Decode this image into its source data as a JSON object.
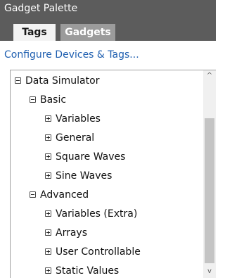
{
  "panel": {
    "title": "Gadget Palette",
    "tabs": [
      {
        "label": "Tags",
        "active": true
      },
      {
        "label": "Gadgets",
        "active": false
      }
    ],
    "configure_link": "Configure Devices & Tags..."
  },
  "tree": {
    "root": {
      "label": "Data Simulator",
      "expanded": true
    },
    "groups": [
      {
        "label": "Basic",
        "expanded": true,
        "items": [
          "Variables",
          "General",
          "Square Waves",
          "Sine Waves"
        ]
      },
      {
        "label": "Advanced",
        "expanded": true,
        "items": [
          "Variables (Extra)",
          "Arrays",
          "User Controllable",
          "Static Values"
        ]
      }
    ]
  },
  "scrollbar": {
    "up_glyph": "^",
    "down_glyph": "v"
  },
  "colors": {
    "title_bar": "#5c5c5c",
    "active_tab": "#f3f3f3",
    "inactive_tab": "#9b9b9b",
    "link": "#1f5fb0",
    "scroll_thumb": "#c4c4c4"
  }
}
